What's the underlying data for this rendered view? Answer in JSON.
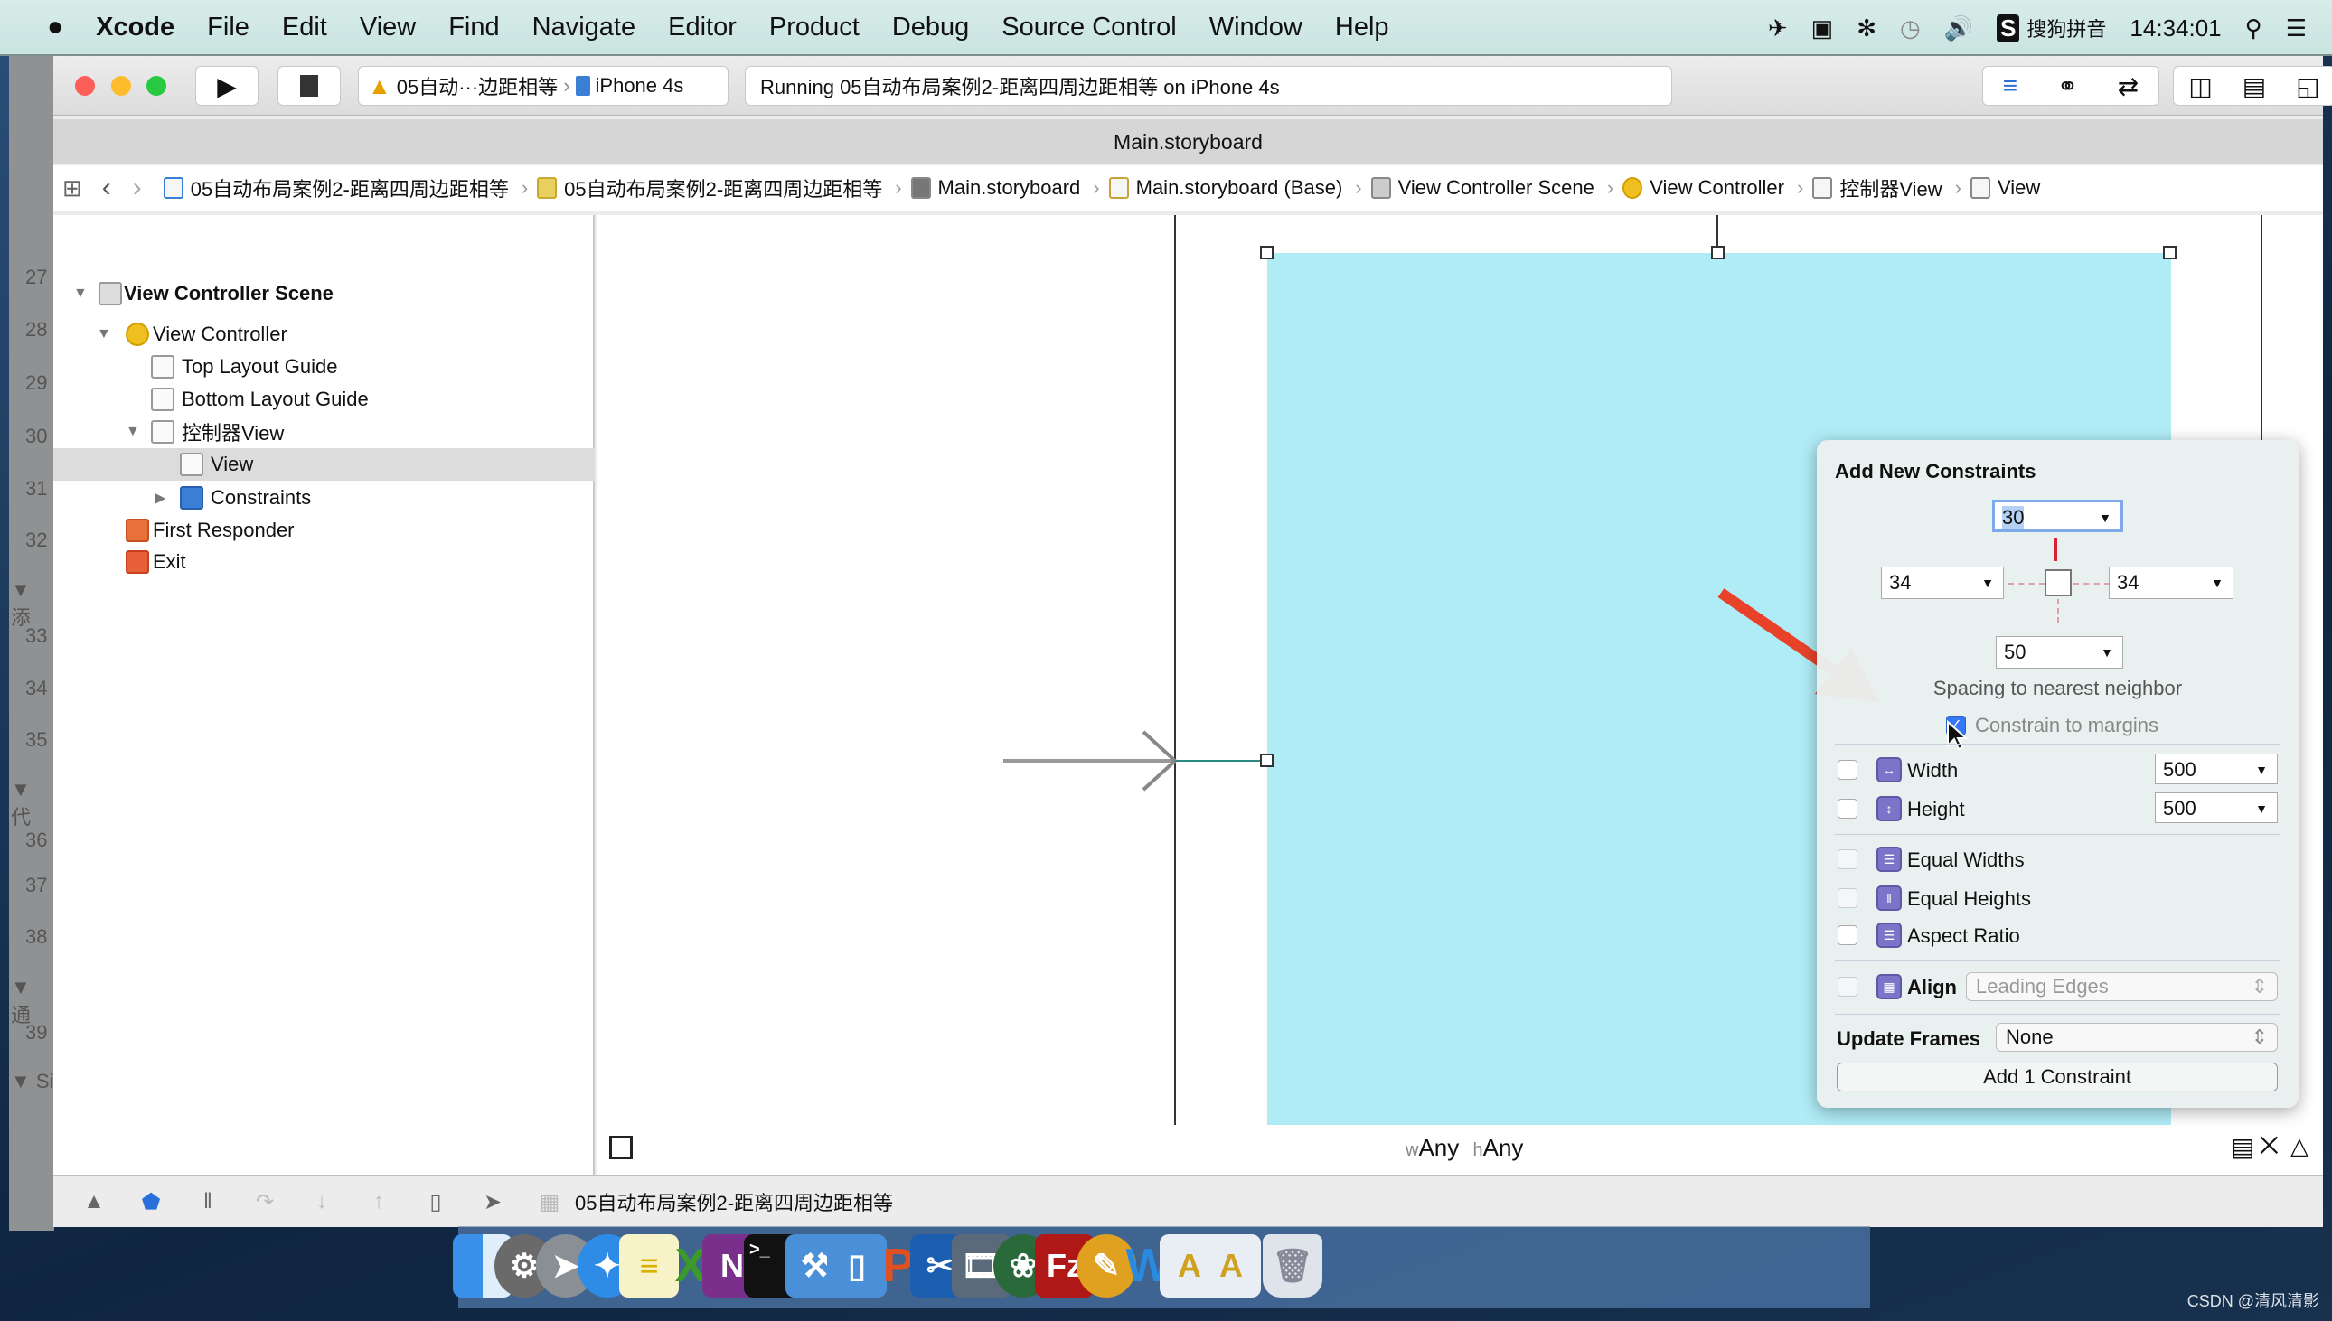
{
  "menubar": {
    "apple": "",
    "app": "Xcode",
    "items": [
      "File",
      "Edit",
      "View",
      "Find",
      "Navigate",
      "Editor",
      "Product",
      "Debug",
      "Source Control",
      "Window",
      "Help"
    ],
    "input_method_badge": "S",
    "input_method": "搜狗拼音",
    "time": "14:34:01"
  },
  "gutter": {
    "lines": [
      "27",
      "28",
      "29",
      "30",
      "31",
      "32",
      "▼ 添",
      "33",
      "34",
      "35",
      "▼ 代",
      "36",
      "37",
      "38",
      "▼ 通",
      "39",
      "▼ Si"
    ]
  },
  "toolbar": {
    "scheme": "05自动···边距相等",
    "device": "iPhone 4s",
    "status": "Running 05自动布局案例2-距离四周边距相等 on iPhone 4s"
  },
  "tab_title": "Main.storyboard",
  "jumpbar": [
    "05自动布局案例2-距离四周边距相等",
    "05自动布局案例2-距离四周边距相等",
    "Main.storyboard",
    "Main.storyboard (Base)",
    "View Controller Scene",
    "View Controller",
    "控制器View",
    "View"
  ],
  "outline": {
    "items": [
      "View Controller Scene",
      "View Controller",
      "Top Layout Guide",
      "Bottom Layout Guide",
      "控制器View",
      "View",
      "Constraints",
      "First Responder",
      "Exit"
    ],
    "selected": "View"
  },
  "canvas": {
    "size_class_w": "w",
    "size_class_w_value": "Any",
    "size_class_h": "h",
    "size_class_h_value": "Any",
    "view_color": "#b0ecf6"
  },
  "popover": {
    "title": "Add New Constraints",
    "top": "30",
    "left": "34",
    "right": "34",
    "bottom": "50",
    "spacing_label": "Spacing to nearest neighbor",
    "constrain_margins_label": "Constrain to margins",
    "constrain_margins_checked": true,
    "width_label": "Width",
    "width_value": "500",
    "width_checked": false,
    "height_label": "Height",
    "height_value": "500",
    "height_checked": false,
    "equal_widths": "Equal Widths",
    "equal_heights": "Equal Heights",
    "aspect_ratio": "Aspect Ratio",
    "align_label": "Align",
    "align_value": "Leading Edges",
    "update_frames_label": "Update Frames",
    "update_frames_value": "None",
    "add_button": "Add 1 Constraint"
  },
  "debugbar": {
    "target": "05自动布局案例2-距离四周边距相等"
  },
  "dock": [
    "finder",
    "system-preferences",
    "launchpad",
    "safari",
    "notes",
    "excel",
    "onenote",
    "terminal",
    "xcode",
    "simulator",
    "powerpoint",
    "screenshot",
    "movie",
    "ftp",
    "filezilla",
    "paint",
    "word",
    "app",
    "app",
    "trash"
  ],
  "watermark": "CSDN @清风清影",
  "colors": {
    "accent": "#3478f6",
    "annotation_arrow": "#e8432a",
    "view_bg": "#b0ecf6"
  }
}
